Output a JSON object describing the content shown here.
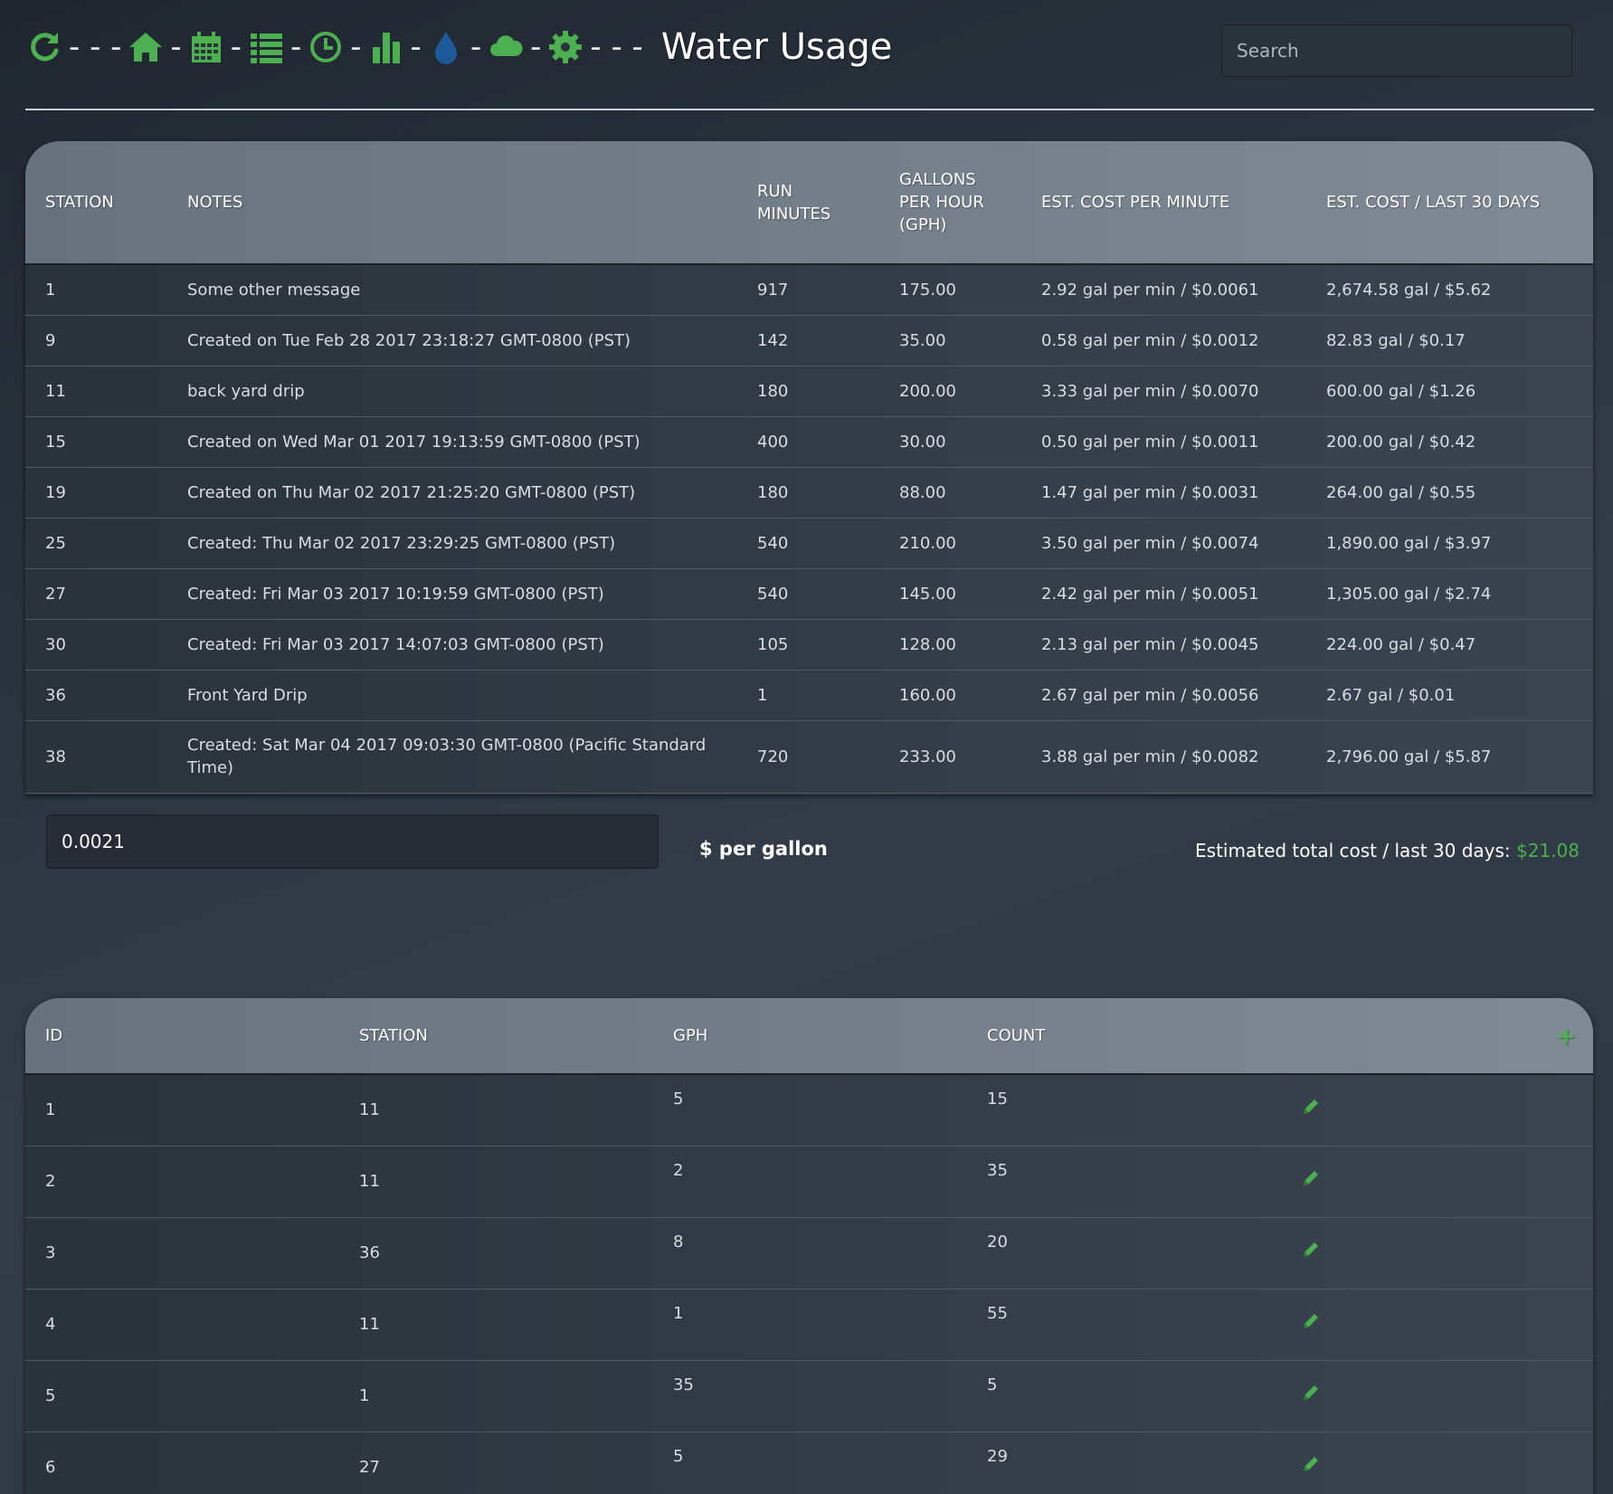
{
  "header": {
    "title": "Water Usage",
    "separator_short": "-",
    "separator_long": "- - -",
    "icons": [
      "refresh-icon",
      "home-icon",
      "calendar-icon",
      "list-icon",
      "clock-icon",
      "bar-chart-icon",
      "water-drop-icon",
      "cloud-icon",
      "gear-icon"
    ],
    "icon_color": "#4caf50",
    "drop_color": "#1e5a99"
  },
  "search": {
    "placeholder": "Search",
    "value": ""
  },
  "usage_table": {
    "headers": [
      "STATION",
      "NOTES",
      "RUN MINUTES",
      "GALLONS PER HOUR (GPH)",
      "EST. COST PER MINUTE",
      "EST. COST / LAST 30 DAYS"
    ],
    "rows": [
      [
        "1",
        "Some other message",
        "917",
        "175.00",
        "2.92 gal per min / $0.0061",
        "2,674.58 gal / $5.62"
      ],
      [
        "9",
        "Created on Tue Feb 28 2017 23:18:27 GMT-0800 (PST)",
        "142",
        "35.00",
        "0.58 gal per min / $0.0012",
        "82.83 gal / $0.17"
      ],
      [
        "11",
        "back yard drip",
        "180",
        "200.00",
        "3.33 gal per min / $0.0070",
        "600.00 gal / $1.26"
      ],
      [
        "15",
        "Created on Wed Mar 01 2017 19:13:59 GMT-0800 (PST)",
        "400",
        "30.00",
        "0.50 gal per min / $0.0011",
        "200.00 gal / $0.42"
      ],
      [
        "19",
        "Created on Thu Mar 02 2017 21:25:20 GMT-0800 (PST)",
        "180",
        "88.00",
        "1.47 gal per min / $0.0031",
        "264.00 gal / $0.55"
      ],
      [
        "25",
        "Created: Thu Mar 02 2017 23:29:25 GMT-0800 (PST)",
        "540",
        "210.00",
        "3.50 gal per min / $0.0074",
        "1,890.00 gal / $3.97"
      ],
      [
        "27",
        "Created: Fri Mar 03 2017 10:19:59 GMT-0800 (PST)",
        "540",
        "145.00",
        "2.42 gal per min / $0.0051",
        "1,305.00 gal / $2.74"
      ],
      [
        "30",
        "Created: Fri Mar 03 2017 14:07:03 GMT-0800 (PST)",
        "105",
        "128.00",
        "2.13 gal per min / $0.0045",
        "224.00 gal / $0.47"
      ],
      [
        "36",
        "Front Yard Drip",
        "1",
        "160.00",
        "2.67 gal per min / $0.0056",
        "2.67 gal / $0.01"
      ],
      [
        "38",
        "Created: Sat Mar 04 2017 09:03:30 GMT-0800 (Pacific Standard Time)",
        "720",
        "233.00",
        "3.88 gal per min / $0.0082",
        "2,796.00 gal / $5.87"
      ]
    ]
  },
  "rate": {
    "value": "0.0021",
    "label": "$ per gallon"
  },
  "total": {
    "label": "Estimated total cost / last 30 days:",
    "value": "$21.08"
  },
  "emitter_table": {
    "headers": [
      "ID",
      "STATION",
      "GPH",
      "COUNT"
    ],
    "add_label": "+",
    "rows": [
      [
        "1",
        "11",
        "5",
        "15"
      ],
      [
        "2",
        "11",
        "2",
        "35"
      ],
      [
        "3",
        "36",
        "8",
        "20"
      ],
      [
        "4",
        "11",
        "1",
        "55"
      ],
      [
        "5",
        "1",
        "35",
        "5"
      ],
      [
        "6",
        "27",
        "5",
        "29"
      ]
    ]
  }
}
